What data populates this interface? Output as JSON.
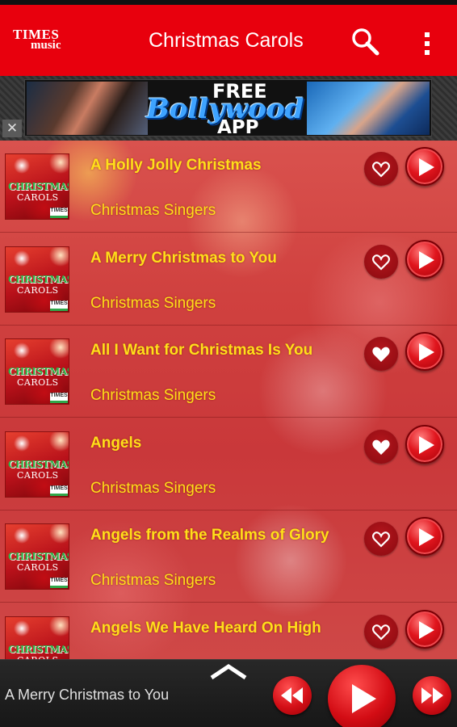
{
  "app_bar": {
    "logo_line1": "TIMES",
    "logo_line2": "music",
    "title": "Christmas Carols",
    "color": "#e8000d"
  },
  "ad": {
    "free_text": "FREE",
    "bollywood_text": "Bollywood",
    "app_text": "APP",
    "close_glyph": "✕"
  },
  "album_art": {
    "title_text": "CHRISTMAS",
    "subtitle_text": "CAROLS",
    "badge_text": "TIMES"
  },
  "songs": [
    {
      "title": "A Holly Jolly Christmas",
      "artist": "Christmas Singers",
      "favorited": false
    },
    {
      "title": "A Merry Christmas to You",
      "artist": "Christmas Singers",
      "favorited": false
    },
    {
      "title": "All I Want for Christmas Is You",
      "artist": "Christmas Singers",
      "favorited": true
    },
    {
      "title": "Angels",
      "artist": "Christmas Singers",
      "favorited": true
    },
    {
      "title": "Angels from the Realms of Glory",
      "artist": "Christmas Singers",
      "favorited": false
    },
    {
      "title": "Angels We Have Heard On High",
      "artist": "Christmas Singers",
      "favorited": false
    }
  ],
  "player": {
    "now_playing": "A Merry Christmas to You"
  },
  "icons": {
    "search": "search-icon",
    "menu": "more-vertical-icon",
    "favorite": "heart-icon",
    "play": "play-icon",
    "previous": "rewind-icon",
    "next": "fast-forward-icon",
    "expand": "chevron-up-icon"
  },
  "colors": {
    "accent_red": "#e8000d",
    "song_text": "#ffdf1a",
    "player_bg": "#1f1f1f"
  }
}
